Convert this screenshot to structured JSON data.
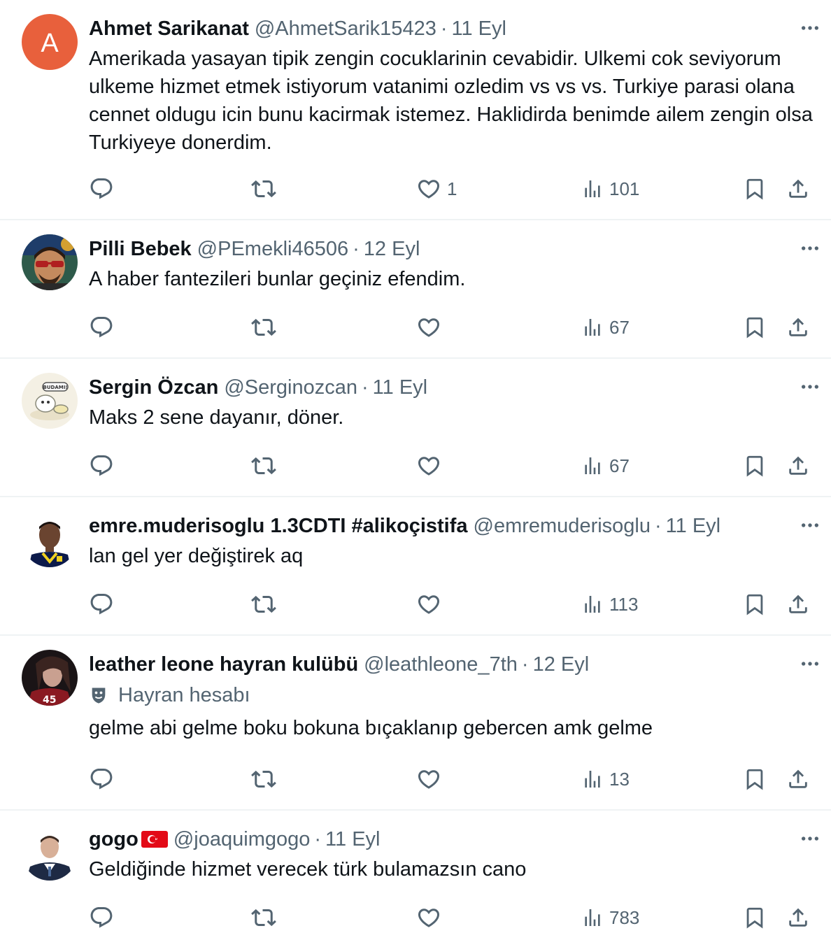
{
  "tweets": [
    {
      "avatar_letter": "A",
      "display_name": "Ahmet Sarikanat",
      "handle": "@AhmetSarik15423",
      "time": "11 Eyl",
      "text": "Amerikada yasayan tipik zengin cocuklarinin cevabidir. Ulkemi cok seviyorum ulkeme hizmet etmek istiyorum vatanimi ozledim vs vs vs. Turkiye parasi olana cennet oldugu icin bunu kacirmak istemez. Haklidirda benimde ailem zengin olsa Turkiyeye donerdim.",
      "likes": "1",
      "views": "101"
    },
    {
      "display_name": "Pilli Bebek",
      "handle": "@PEmekli46506",
      "time": "12 Eyl",
      "text": "A haber fantezileri bunlar geçiniz efendim.",
      "views": "67"
    },
    {
      "display_name": "Sergin Özcan",
      "handle": "@Serginozcan",
      "time": "11 Eyl",
      "text": "Maks 2 sene dayanır, döner.",
      "views": "67"
    },
    {
      "display_name": "emre.muderisoglu 1.3CDTI #alikoçistifa",
      "handle": "@emremuderisoglu",
      "time": "11 Eyl",
      "text": "lan gel yer değiştirek aq",
      "views": "113"
    },
    {
      "display_name": "leather leone hayran kulübü",
      "handle": "@leathleone_7th",
      "time": "12 Eyl",
      "badge": "Hayran hesabı",
      "text": "gelme abi gelme boku bokuna bıçaklanıp gebercen amk gelme",
      "views": "13"
    },
    {
      "display_name": "gogo",
      "handle": "@joaquimgogo",
      "time": "11 Eyl",
      "text": "Geldiğinde hizmet verecek türk bulamazsın cano",
      "views": "783"
    }
  ],
  "separator": "·",
  "colors": {
    "secondary": "#536471",
    "primary": "#0f1419",
    "avatar_orange": "#e8603c"
  }
}
